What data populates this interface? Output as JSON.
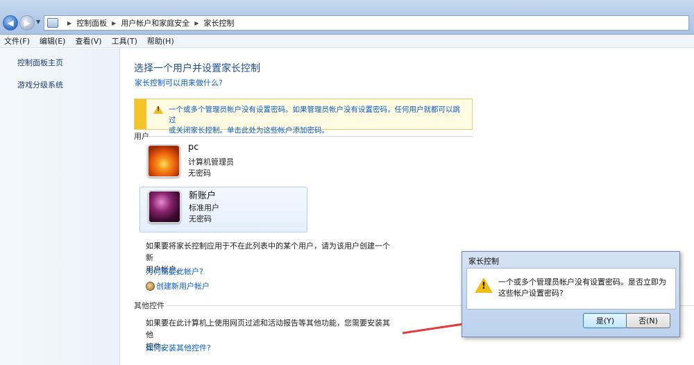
{
  "breadcrumb": [
    "控制面板",
    "用户帐户和家庭安全",
    "家长控制"
  ],
  "menu": [
    "文件(F)",
    "编辑(E)",
    "查看(V)",
    "工具(T)",
    "帮助(H)"
  ],
  "sidebar": {
    "items": [
      "控制面板主页",
      "游戏分级系统"
    ]
  },
  "main": {
    "title": "选择一个用户并设置家长控制",
    "help_link": "家长控制可以用来做什么?",
    "warning": {
      "line1": "一个或多个管理员帐户没有设置密码。如果管理员帐户没有设置密码，任何用户就都可以跳过",
      "line2": "或关闭家长控制。单击此处为这些帐户添加密码。"
    },
    "users_label": "用户",
    "users": [
      {
        "name": "pc",
        "role": "计算机管理员",
        "password": "无密码"
      },
      {
        "name": "新账户",
        "role": "标准用户",
        "password": "无密码"
      }
    ],
    "create_info": {
      "line1": "如果要将家长控制应用于不在此列表中的某个用户，请为该用户创建一个新",
      "line2": "用户帐户。"
    },
    "why_link": "为何需要此帐户?",
    "create_link": "创建新用户帐户",
    "other_label": "其他控件",
    "other_info": {
      "line1": "如果要在此计算机上使用网页过滤和活动报告等其他功能，您需要安装其他",
      "line2": "控件。"
    },
    "install_link": "如何安装其他控件?"
  },
  "dialog": {
    "title": "家长控制",
    "message": "一个或多个管理员帐户没有设置密码。是否立即为这些帐户设置密码?",
    "yes": "是(Y)",
    "no": "否(N)"
  },
  "colors": {
    "link": "#0b5ec9",
    "title": "#1f4e96",
    "arrow": "#e23b3b"
  },
  "icons": [
    "back-arrow-icon",
    "forward-arrow-icon",
    "control-panel-icon",
    "warning-icon",
    "people-icon"
  ]
}
